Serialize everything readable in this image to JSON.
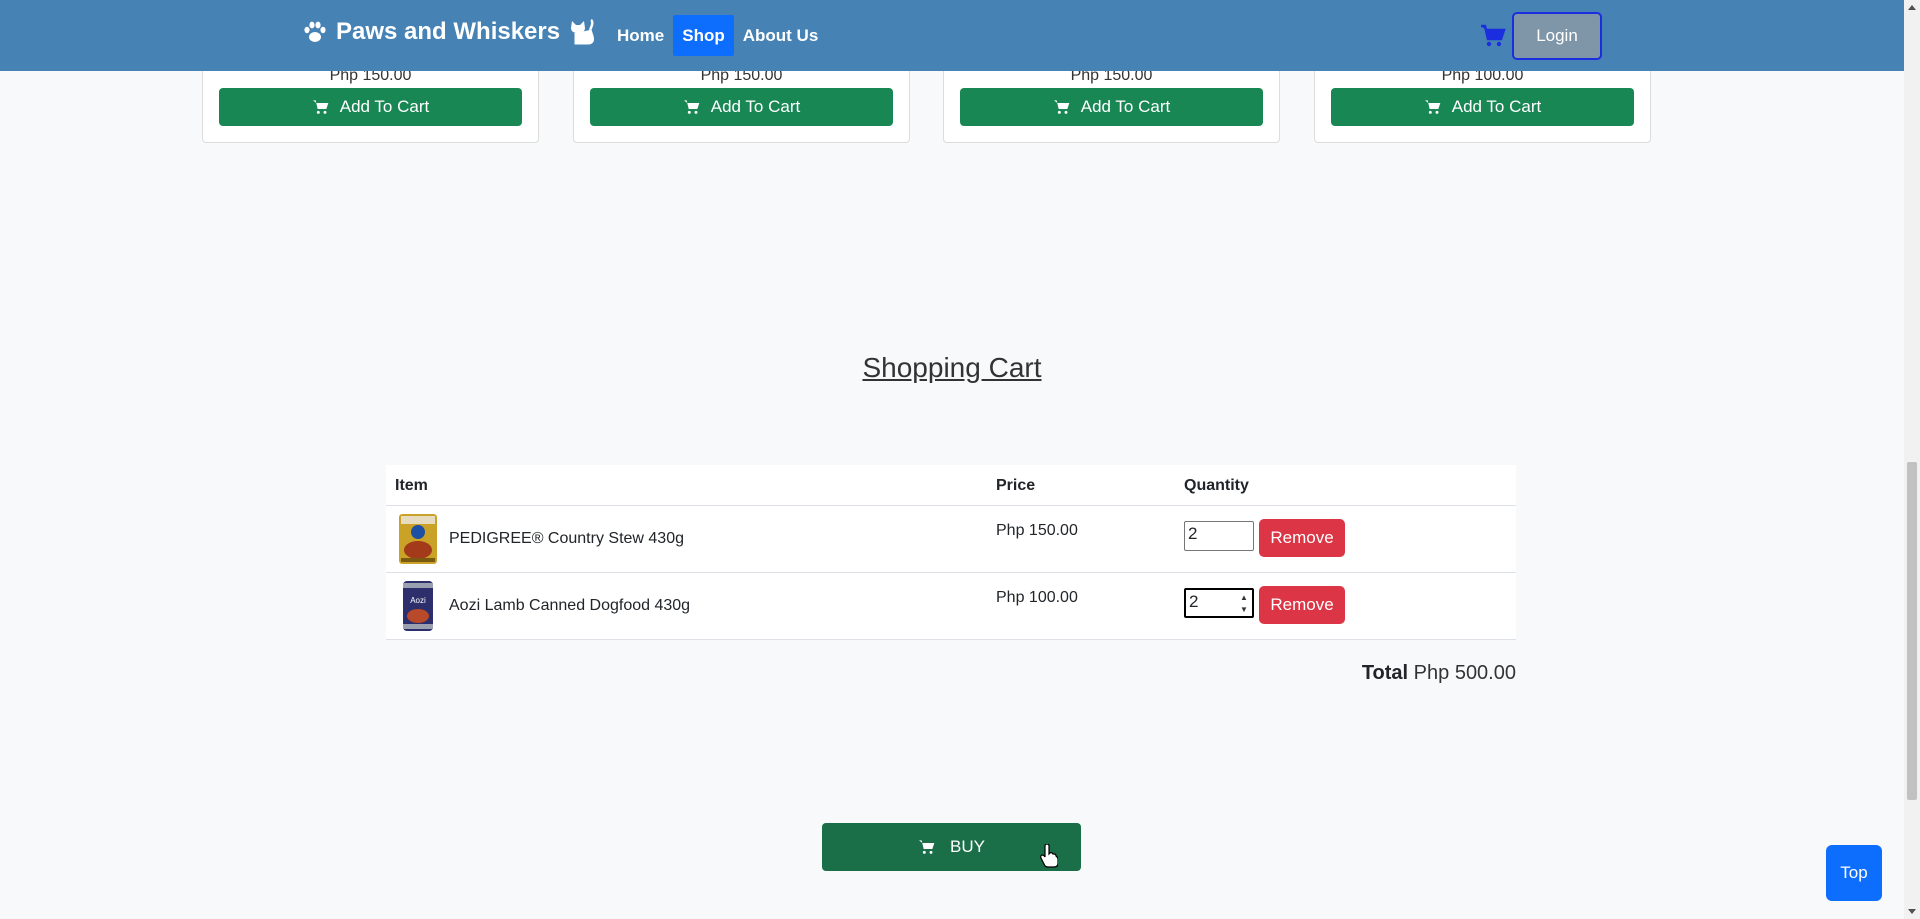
{
  "navbar": {
    "brand": "Paws and Whiskers",
    "links": [
      {
        "label": "Home"
      },
      {
        "label": "Shop"
      },
      {
        "label": "About Us"
      }
    ],
    "login_label": "Login"
  },
  "products": [
    {
      "price": "Php 150.00",
      "button": "Add To Cart"
    },
    {
      "price": "Php 150.00",
      "button": "Add To Cart"
    },
    {
      "price": "Php 150.00",
      "button": "Add To Cart"
    },
    {
      "price": "Php 100.00",
      "button": "Add To Cart"
    }
  ],
  "cart": {
    "title": "Shopping Cart",
    "headers": {
      "item": "Item",
      "price": "Price",
      "quantity": "Quantity"
    },
    "rows": [
      {
        "name": "PEDIGREE® Country Stew 430g",
        "price": "Php 150.00",
        "quantity": "2",
        "remove": "Remove"
      },
      {
        "name": "Aozi Lamb Canned Dogfood 430g",
        "price": "Php 100.00",
        "quantity": "2",
        "remove": "Remove"
      }
    ],
    "total_label": "Total",
    "total_value": "Php 500.00",
    "buy_label": "BUY"
  },
  "top_label": "Top",
  "colors": {
    "navbar": "#4682b4",
    "active_link": "#0d6efd",
    "add_to_cart": "#198754",
    "remove": "#dc3545",
    "buy": "#1a6e48"
  }
}
